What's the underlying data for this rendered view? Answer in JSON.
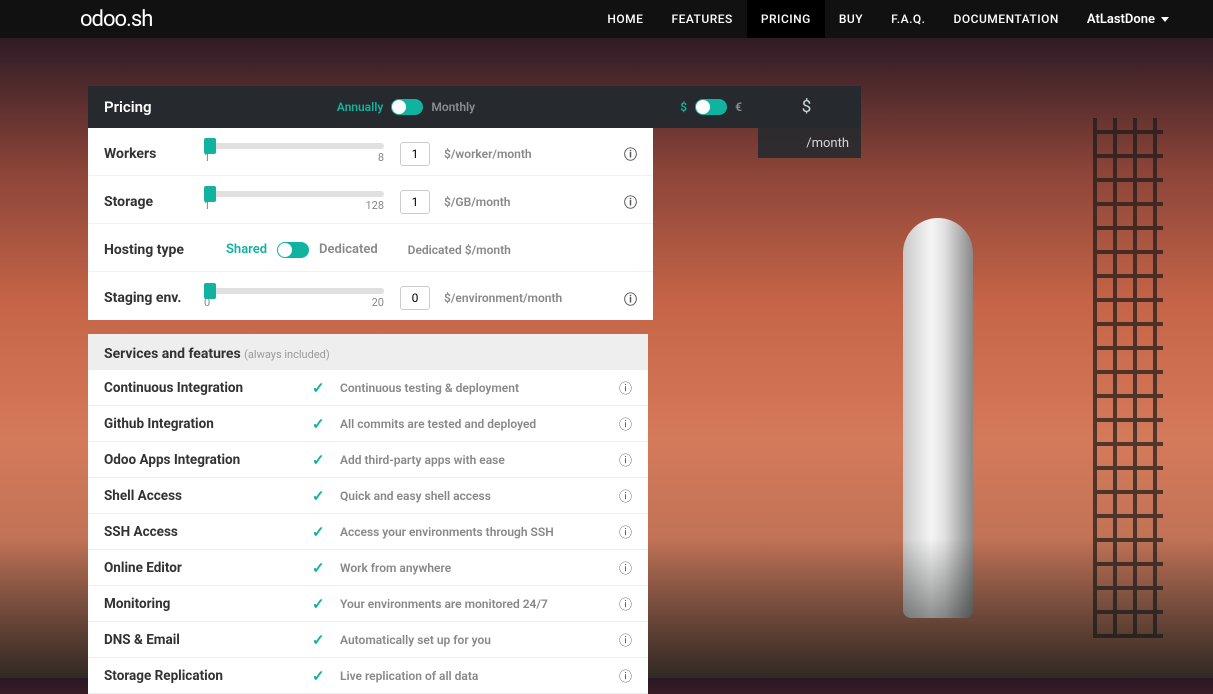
{
  "nav": {
    "logo": "odoo.sh",
    "items": [
      "HOME",
      "FEATURES",
      "PRICING",
      "BUY",
      "F.A.Q.",
      "DOCUMENTATION"
    ],
    "active_index": 2,
    "user": "AtLastDone"
  },
  "pricing": {
    "title": "Pricing",
    "period": {
      "left": "Annually",
      "right": "Monthly",
      "value": "Annually"
    },
    "currency": {
      "left": "$",
      "right": "€",
      "value": "$"
    },
    "total_currency": "$",
    "total_suffix": "/month",
    "rows": {
      "workers": {
        "label": "Workers",
        "min": "1",
        "max": "8",
        "value": "1",
        "unit": "$/worker/month"
      },
      "storage": {
        "label": "Storage",
        "min": "1",
        "max": "128",
        "value": "1",
        "unit": "$/GB/month"
      },
      "hosting": {
        "label": "Hosting type",
        "left": "Shared",
        "right": "Dedicated",
        "value": "Shared",
        "unit": "Dedicated $/month"
      },
      "staging": {
        "label": "Staging env.",
        "min": "0",
        "max": "20",
        "value": "0",
        "unit": "$/environment/month"
      }
    }
  },
  "features": {
    "title": "Services and features",
    "subtitle": "(always included)",
    "items": [
      {
        "name": "Continuous Integration",
        "desc": "Continuous testing & deployment"
      },
      {
        "name": "Github Integration",
        "desc": "All commits are tested and deployed"
      },
      {
        "name": "Odoo Apps Integration",
        "desc": "Add third-party apps with ease"
      },
      {
        "name": "Shell Access",
        "desc": "Quick and easy shell access"
      },
      {
        "name": "SSH Access",
        "desc": "Access your environments through SSH"
      },
      {
        "name": "Online Editor",
        "desc": "Work from anywhere"
      },
      {
        "name": "Monitoring",
        "desc": "Your environments are monitored 24/7"
      },
      {
        "name": "DNS & Email",
        "desc": "Automatically set up for you"
      },
      {
        "name": "Storage Replication",
        "desc": "Live replication of all data"
      }
    ]
  }
}
